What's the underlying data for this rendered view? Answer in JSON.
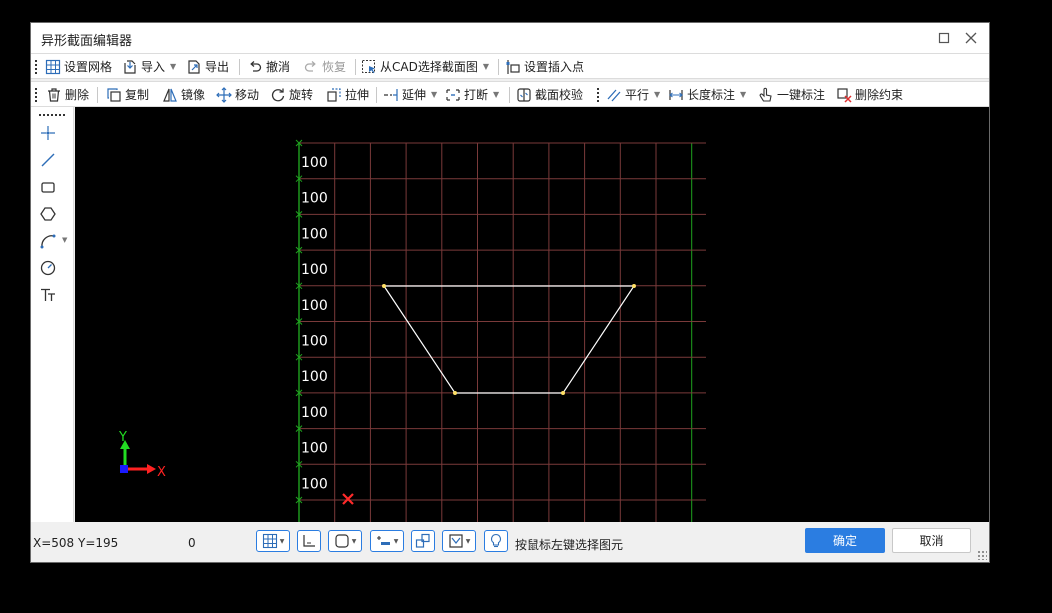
{
  "window": {
    "title": "异形截面编辑器"
  },
  "titlebar_icons": [
    "maximize-icon",
    "close-icon"
  ],
  "toolbar1": [
    {
      "name": "set-grid",
      "label": "设置网格",
      "icon": "grid-icon",
      "dropdown": false,
      "disabled": false
    },
    {
      "name": "import",
      "label": "导入",
      "icon": "import-icon",
      "dropdown": true,
      "disabled": false
    },
    {
      "name": "export",
      "label": "导出",
      "icon": "export-icon",
      "dropdown": false,
      "disabled": false
    },
    {
      "name": "undo",
      "label": "撤消",
      "icon": "undo-icon",
      "dropdown": false,
      "disabled": false
    },
    {
      "name": "redo",
      "label": "恢复",
      "icon": "redo-icon",
      "dropdown": false,
      "disabled": true
    },
    {
      "name": "select-from-cad",
      "label": "从CAD选择截面图",
      "icon": "cad-select-icon",
      "dropdown": true,
      "disabled": false
    },
    {
      "name": "set-insert-point",
      "label": "设置插入点",
      "icon": "insert-point-icon",
      "dropdown": false,
      "disabled": false
    }
  ],
  "toolbar2": [
    {
      "name": "delete",
      "label": "删除",
      "icon": "trash-icon",
      "dropdown": false
    },
    {
      "name": "copy",
      "label": "复制",
      "icon": "copy-icon",
      "dropdown": false
    },
    {
      "name": "mirror",
      "label": "镜像",
      "icon": "mirror-icon",
      "dropdown": false
    },
    {
      "name": "move",
      "label": "移动",
      "icon": "move-icon",
      "dropdown": false
    },
    {
      "name": "rotate",
      "label": "旋转",
      "icon": "rotate-icon",
      "dropdown": false
    },
    {
      "name": "stretch",
      "label": "拉伸",
      "icon": "stretch-icon",
      "dropdown": false
    },
    {
      "name": "extend",
      "label": "延伸",
      "icon": "extend-icon",
      "dropdown": true
    },
    {
      "name": "break",
      "label": "打断",
      "icon": "break-icon",
      "dropdown": true
    },
    {
      "name": "section-check",
      "label": "截面校验",
      "icon": "section-check-icon",
      "dropdown": false
    },
    {
      "name": "parallel",
      "label": "平行",
      "icon": "parallel-icon",
      "dropdown": true
    },
    {
      "name": "length-dimension",
      "label": "长度标注",
      "icon": "length-dimension-icon",
      "dropdown": true
    },
    {
      "name": "one-click-dimension",
      "label": "一键标注",
      "icon": "one-click-dimension-icon",
      "dropdown": false
    },
    {
      "name": "delete-constraint",
      "label": "删除约束",
      "icon": "delete-constraint-icon",
      "dropdown": false
    }
  ],
  "left_tools": [
    "point-icon",
    "line-icon",
    "rectangle-icon",
    "polygon-icon",
    "arc-icon",
    "circle-icon",
    "text-icon"
  ],
  "canvas": {
    "grid_labels": [
      "100",
      "100",
      "100",
      "100",
      "100",
      "100",
      "100",
      "100",
      "100",
      "100"
    ],
    "axis_x_label": "X",
    "axis_y_label": "Y",
    "colors": {
      "background": "#000000",
      "grid_line": "#7a3a3a",
      "grid_axis": "#1fa31f",
      "shape_line": "#ffffff",
      "vertex": "#ffe066",
      "origin_marker": "#ff2a2a",
      "axis_x": "#ff2222",
      "axis_y": "#22dd22"
    }
  },
  "status": {
    "coords": "X=508 Y=195",
    "value": "0",
    "hint": "按鼠标左键选择图元",
    "buttons": [
      "grid-snap-icon",
      "ortho-icon",
      "object-snap-icon",
      "polar-icon",
      "shape-snap-icon",
      "dynamic-input-icon",
      "lightbulb-icon"
    ],
    "ok_label": "确定",
    "cancel_label": "取消"
  }
}
